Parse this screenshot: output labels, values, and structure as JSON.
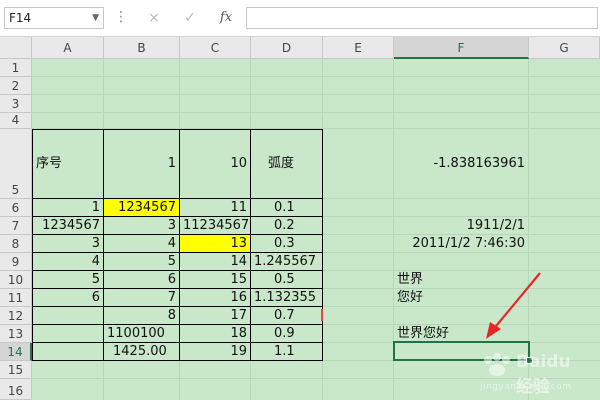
{
  "formula_bar": {
    "name_box": "F14",
    "cancel_icon": "×",
    "enter_icon": "✓",
    "fx_label": "fx",
    "formula_value": ""
  },
  "columns": [
    "A",
    "B",
    "C",
    "D",
    "E",
    "F",
    "G"
  ],
  "rows": [
    "1",
    "2",
    "3",
    "4",
    "5",
    "6",
    "7",
    "8",
    "9",
    "10",
    "11",
    "12",
    "13",
    "14",
    "15",
    "16"
  ],
  "cells": {
    "A5": "序号",
    "B5": "1",
    "C5": "10",
    "D5": "弧度",
    "F5": "-1.838163961",
    "A6": "1",
    "B6": "1234567",
    "C6": "11",
    "D6": "0.1",
    "A7": "1234567",
    "B7": "3",
    "C7": "11234567",
    "D7": "0.2",
    "F7": "1911/2/1",
    "A8": "3",
    "B8": "4",
    "C8": "13",
    "D8": "0.3",
    "F8": "2011/1/2 7:46:30",
    "A9": "4",
    "B9": "5",
    "C9": "14",
    "D9": "1.245567",
    "A10": "5",
    "B10": "6",
    "C10": "15",
    "D10": "0.5",
    "F10": "世界",
    "A11": "6",
    "B11": "7",
    "C11": "16",
    "D11": "1.132355",
    "F11": "您好",
    "B12": "8",
    "C12": "17",
    "D12": "0.7",
    "B13": "1100100",
    "C13": "18",
    "D13": "0.9",
    "F13": "世界您好",
    "B14": "1425.00",
    "C14": "19",
    "D14": "1.1"
  },
  "highlighted_cells": [
    "B6",
    "C8"
  ],
  "highlight_color": "#ffff00",
  "selected_cell": "F14",
  "accent_color": "#217346",
  "annotation_color": "#e8262a",
  "watermark": {
    "title": "Baidu 经验",
    "url": "jingyan.baidu.com"
  }
}
